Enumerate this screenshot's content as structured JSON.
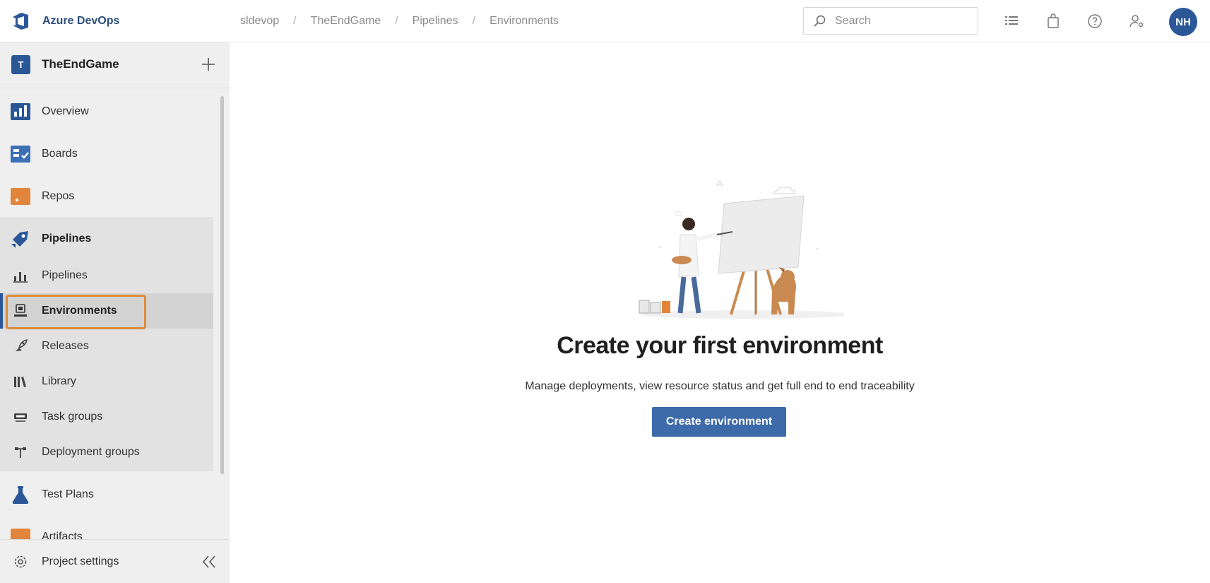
{
  "app": {
    "brand_name": "Azure DevOps",
    "brand_icon": "azure-devops-logo-icon"
  },
  "breadcrumb": [
    "sldevop",
    "TheEndGame",
    "Pipelines",
    "Environments"
  ],
  "breadcrumb_separator": "/",
  "search": {
    "placeholder": "Search",
    "icon": "search-icon"
  },
  "top_icons": [
    "work-items-icon",
    "marketplace-bag-icon",
    "help-icon",
    "user-settings-icon"
  ],
  "user": {
    "initials": "NH"
  },
  "sidebar": {
    "project": {
      "initial": "T",
      "name": "TheEndGame",
      "add_icon": "plus-icon"
    },
    "items": [
      {
        "label": "Overview",
        "icon": "overview-icon"
      },
      {
        "label": "Boards",
        "icon": "boards-icon"
      },
      {
        "label": "Repos",
        "icon": "repos-icon"
      },
      {
        "label": "Pipelines",
        "icon": "pipelines-icon"
      },
      {
        "label": "Pipelines",
        "icon": "pipelines-sub-icon"
      },
      {
        "label": "Environments",
        "icon": "environments-icon",
        "selected": true
      },
      {
        "label": "Releases",
        "icon": "releases-icon"
      },
      {
        "label": "Library",
        "icon": "library-icon"
      },
      {
        "label": "Task groups",
        "icon": "task-groups-icon"
      },
      {
        "label": "Deployment groups",
        "icon": "deployment-groups-icon"
      },
      {
        "label": "Test Plans",
        "icon": "test-plans-icon"
      },
      {
        "label": "Artifacts",
        "icon": "artifacts-icon"
      }
    ],
    "footer": {
      "label": "Project settings",
      "icon": "gear-icon",
      "collapse_icon": "collapse-chevron-icon"
    }
  },
  "main": {
    "illustration": "artist-painting-easel-with-dog-illustration",
    "headline": "Create your first environment",
    "description": "Manage deployments, view resource status and get full end to end traceability",
    "primary_button": "Create environment"
  },
  "colors": {
    "brand_blue": "#2b5797",
    "button_blue": "#3d6aa8",
    "highlight_orange": "#e08a3a",
    "sidebar_bg": "#efefef"
  }
}
